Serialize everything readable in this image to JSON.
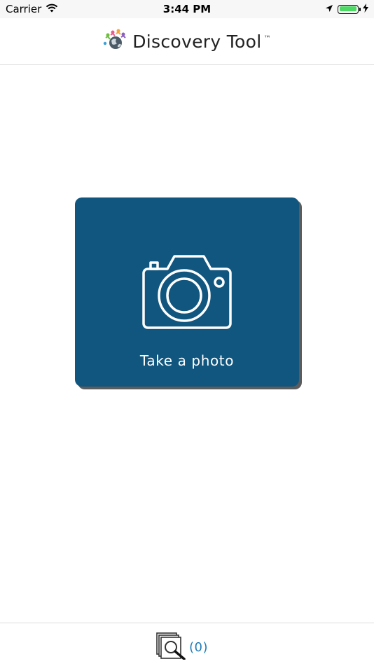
{
  "status_bar": {
    "carrier": "Carrier",
    "time": "3:44 PM",
    "battery_level": 1.0,
    "battery_color": "#4cd964"
  },
  "header": {
    "title": "Discovery Tool",
    "trademark": "™",
    "logo_icon": "globe-people-icon"
  },
  "main": {
    "take_photo_label": "Take a photo",
    "card_color": "#10567f",
    "icon": "camera-icon"
  },
  "bottom_bar": {
    "gallery_count": "(0)",
    "gallery_icon": "photo-stack-magnifier-icon",
    "accent_color": "#1f7db8"
  }
}
